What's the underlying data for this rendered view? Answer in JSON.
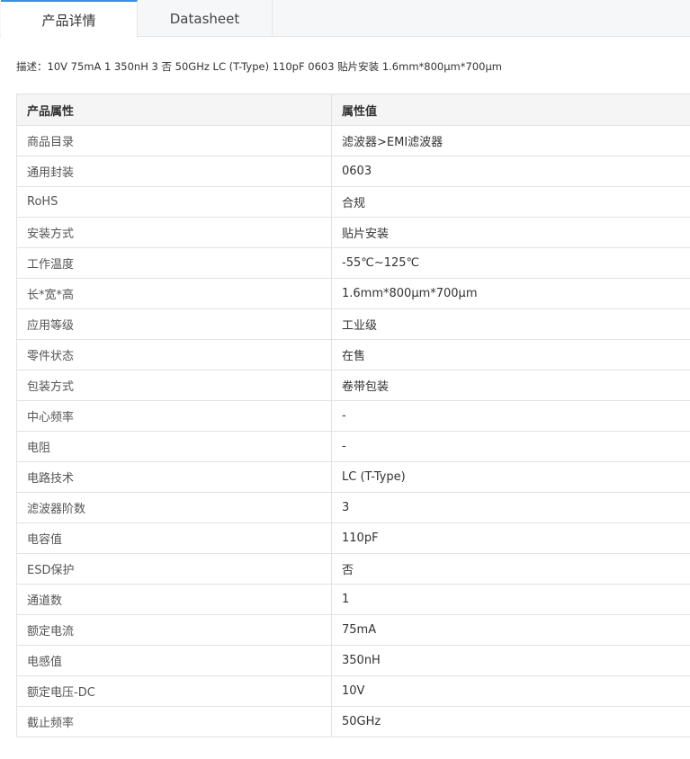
{
  "tabs": [
    {
      "label": "产品详情",
      "active": true
    },
    {
      "label": "Datasheet",
      "active": false
    }
  ],
  "description": "描述：10V 75mA 1 350nH 3 否 50GHz LC (T-Type) 110pF 0603 贴片安装 1.6mm*800μm*700μm",
  "table": {
    "headers": [
      "产品属性",
      "属性值"
    ],
    "rows": [
      {
        "name": "商品目录",
        "value": "滤波器>EMI滤波器"
      },
      {
        "name": "通用封装",
        "value": "0603"
      },
      {
        "name": "RoHS",
        "value": "合规"
      },
      {
        "name": "安装方式",
        "value": "贴片安装"
      },
      {
        "name": "工作温度",
        "value": "-55℃~125℃"
      },
      {
        "name": "长*宽*高",
        "value": "1.6mm*800μm*700μm"
      },
      {
        "name": "应用等级",
        "value": "工业级"
      },
      {
        "name": "零件状态",
        "value": "在售"
      },
      {
        "name": "包装方式",
        "value": "卷带包装"
      },
      {
        "name": "中心频率",
        "value": "-"
      },
      {
        "name": "电阻",
        "value": "-"
      },
      {
        "name": "电路技术",
        "value": "LC (T-Type)"
      },
      {
        "name": "滤波器阶数",
        "value": "3"
      },
      {
        "name": "电容值",
        "value": "110pF"
      },
      {
        "name": "ESD保护",
        "value": "否"
      },
      {
        "name": "通道数",
        "value": "1"
      },
      {
        "name": "额定电流",
        "value": "75mA"
      },
      {
        "name": "电感值",
        "value": "350nH"
      },
      {
        "name": "额定电压-DC",
        "value": "10V"
      },
      {
        "name": "截止频率",
        "value": "50GHz"
      }
    ]
  },
  "colors": {
    "active_tab_accent": "#3a8ee6",
    "header_bg": "#f5f5f5",
    "border": "#e2e2e2"
  }
}
